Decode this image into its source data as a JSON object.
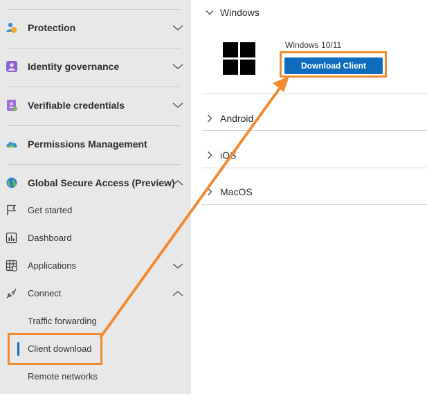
{
  "sidebar": {
    "sections": [
      {
        "label": "Protection",
        "icon": "users-shield-icon"
      },
      {
        "label": "Identity governance",
        "icon": "identity-governance-icon"
      },
      {
        "label": "Verifiable credentials",
        "icon": "credentials-icon"
      },
      {
        "label": "Permissions Management",
        "icon": "cloud-icon"
      },
      {
        "label": "Global Secure Access (Preview)",
        "icon": "globe-icon"
      }
    ],
    "sub_items": [
      {
        "label": "Get started",
        "icon": "flag-icon"
      },
      {
        "label": "Dashboard",
        "icon": "dashboard-icon"
      },
      {
        "label": "Applications",
        "icon": "grid-icon"
      },
      {
        "label": "Connect",
        "icon": "plug-icon"
      }
    ],
    "connect_children": [
      {
        "label": "Traffic forwarding"
      },
      {
        "label": "Client download",
        "selected": true
      },
      {
        "label": "Remote networks"
      }
    ]
  },
  "main": {
    "sections": [
      {
        "label": "Windows",
        "expanded": true
      },
      {
        "label": "Android",
        "expanded": false
      },
      {
        "label": "iOS",
        "expanded": false
      },
      {
        "label": "MacOS",
        "expanded": false
      }
    ],
    "windows": {
      "os_title": "Windows 10/11",
      "download_label": "Download Client"
    }
  },
  "colors": {
    "accent": "#0f6cbd",
    "highlight": "#f38a2f",
    "sidebar_bg": "#e8e8e8"
  }
}
